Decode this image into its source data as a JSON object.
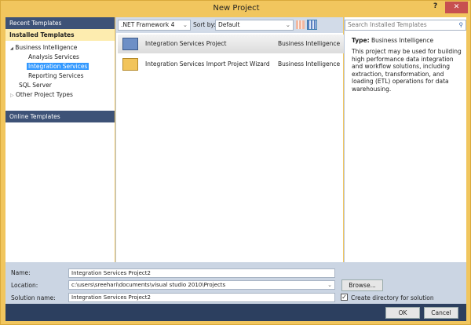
{
  "window": {
    "title": "New Project",
    "help": "?",
    "close": "✕"
  },
  "left": {
    "recent": "Recent Templates",
    "installed": "Installed Templates",
    "tree": [
      {
        "label": "Business Intelligence",
        "expander": "◢"
      },
      {
        "label": "Analysis Services"
      },
      {
        "label": "Integration Services",
        "selected": true
      },
      {
        "label": "Reporting Services"
      },
      {
        "label": "SQL Server"
      },
      {
        "label": "Other Project Types",
        "expander": "▷"
      }
    ],
    "online": "Online Templates"
  },
  "toolbar": {
    "framework": ".NET Framework 4",
    "sort_label": "Sort by:",
    "sort_value": "Default"
  },
  "templates": [
    {
      "name": "Integration Services Project",
      "category": "Business Intelligence",
      "selected": true
    },
    {
      "name": "Integration Services Import Project Wizard",
      "category": "Business Intelligence"
    }
  ],
  "details": {
    "search_placeholder": "Search Installed Templates",
    "type_label": "Type:",
    "type_value": "Business Intelligence",
    "description": "This project may be used for building high performance data integration and workflow solutions, including extraction, transformation, and loading (ETL) operations for data warehousing."
  },
  "form": {
    "name_label": "Name:",
    "name_value": "Integration Services Project2",
    "location_label": "Location:",
    "location_value": "c:\\users\\sreehari\\documents\\visual studio 2010\\Projects",
    "solution_label": "Solution name:",
    "solution_value": "Integration Services Project2",
    "browse": "Browse...",
    "create_dir": "Create directory for solution",
    "create_dir_checked": true
  },
  "buttons": {
    "ok": "OK",
    "cancel": "Cancel"
  }
}
